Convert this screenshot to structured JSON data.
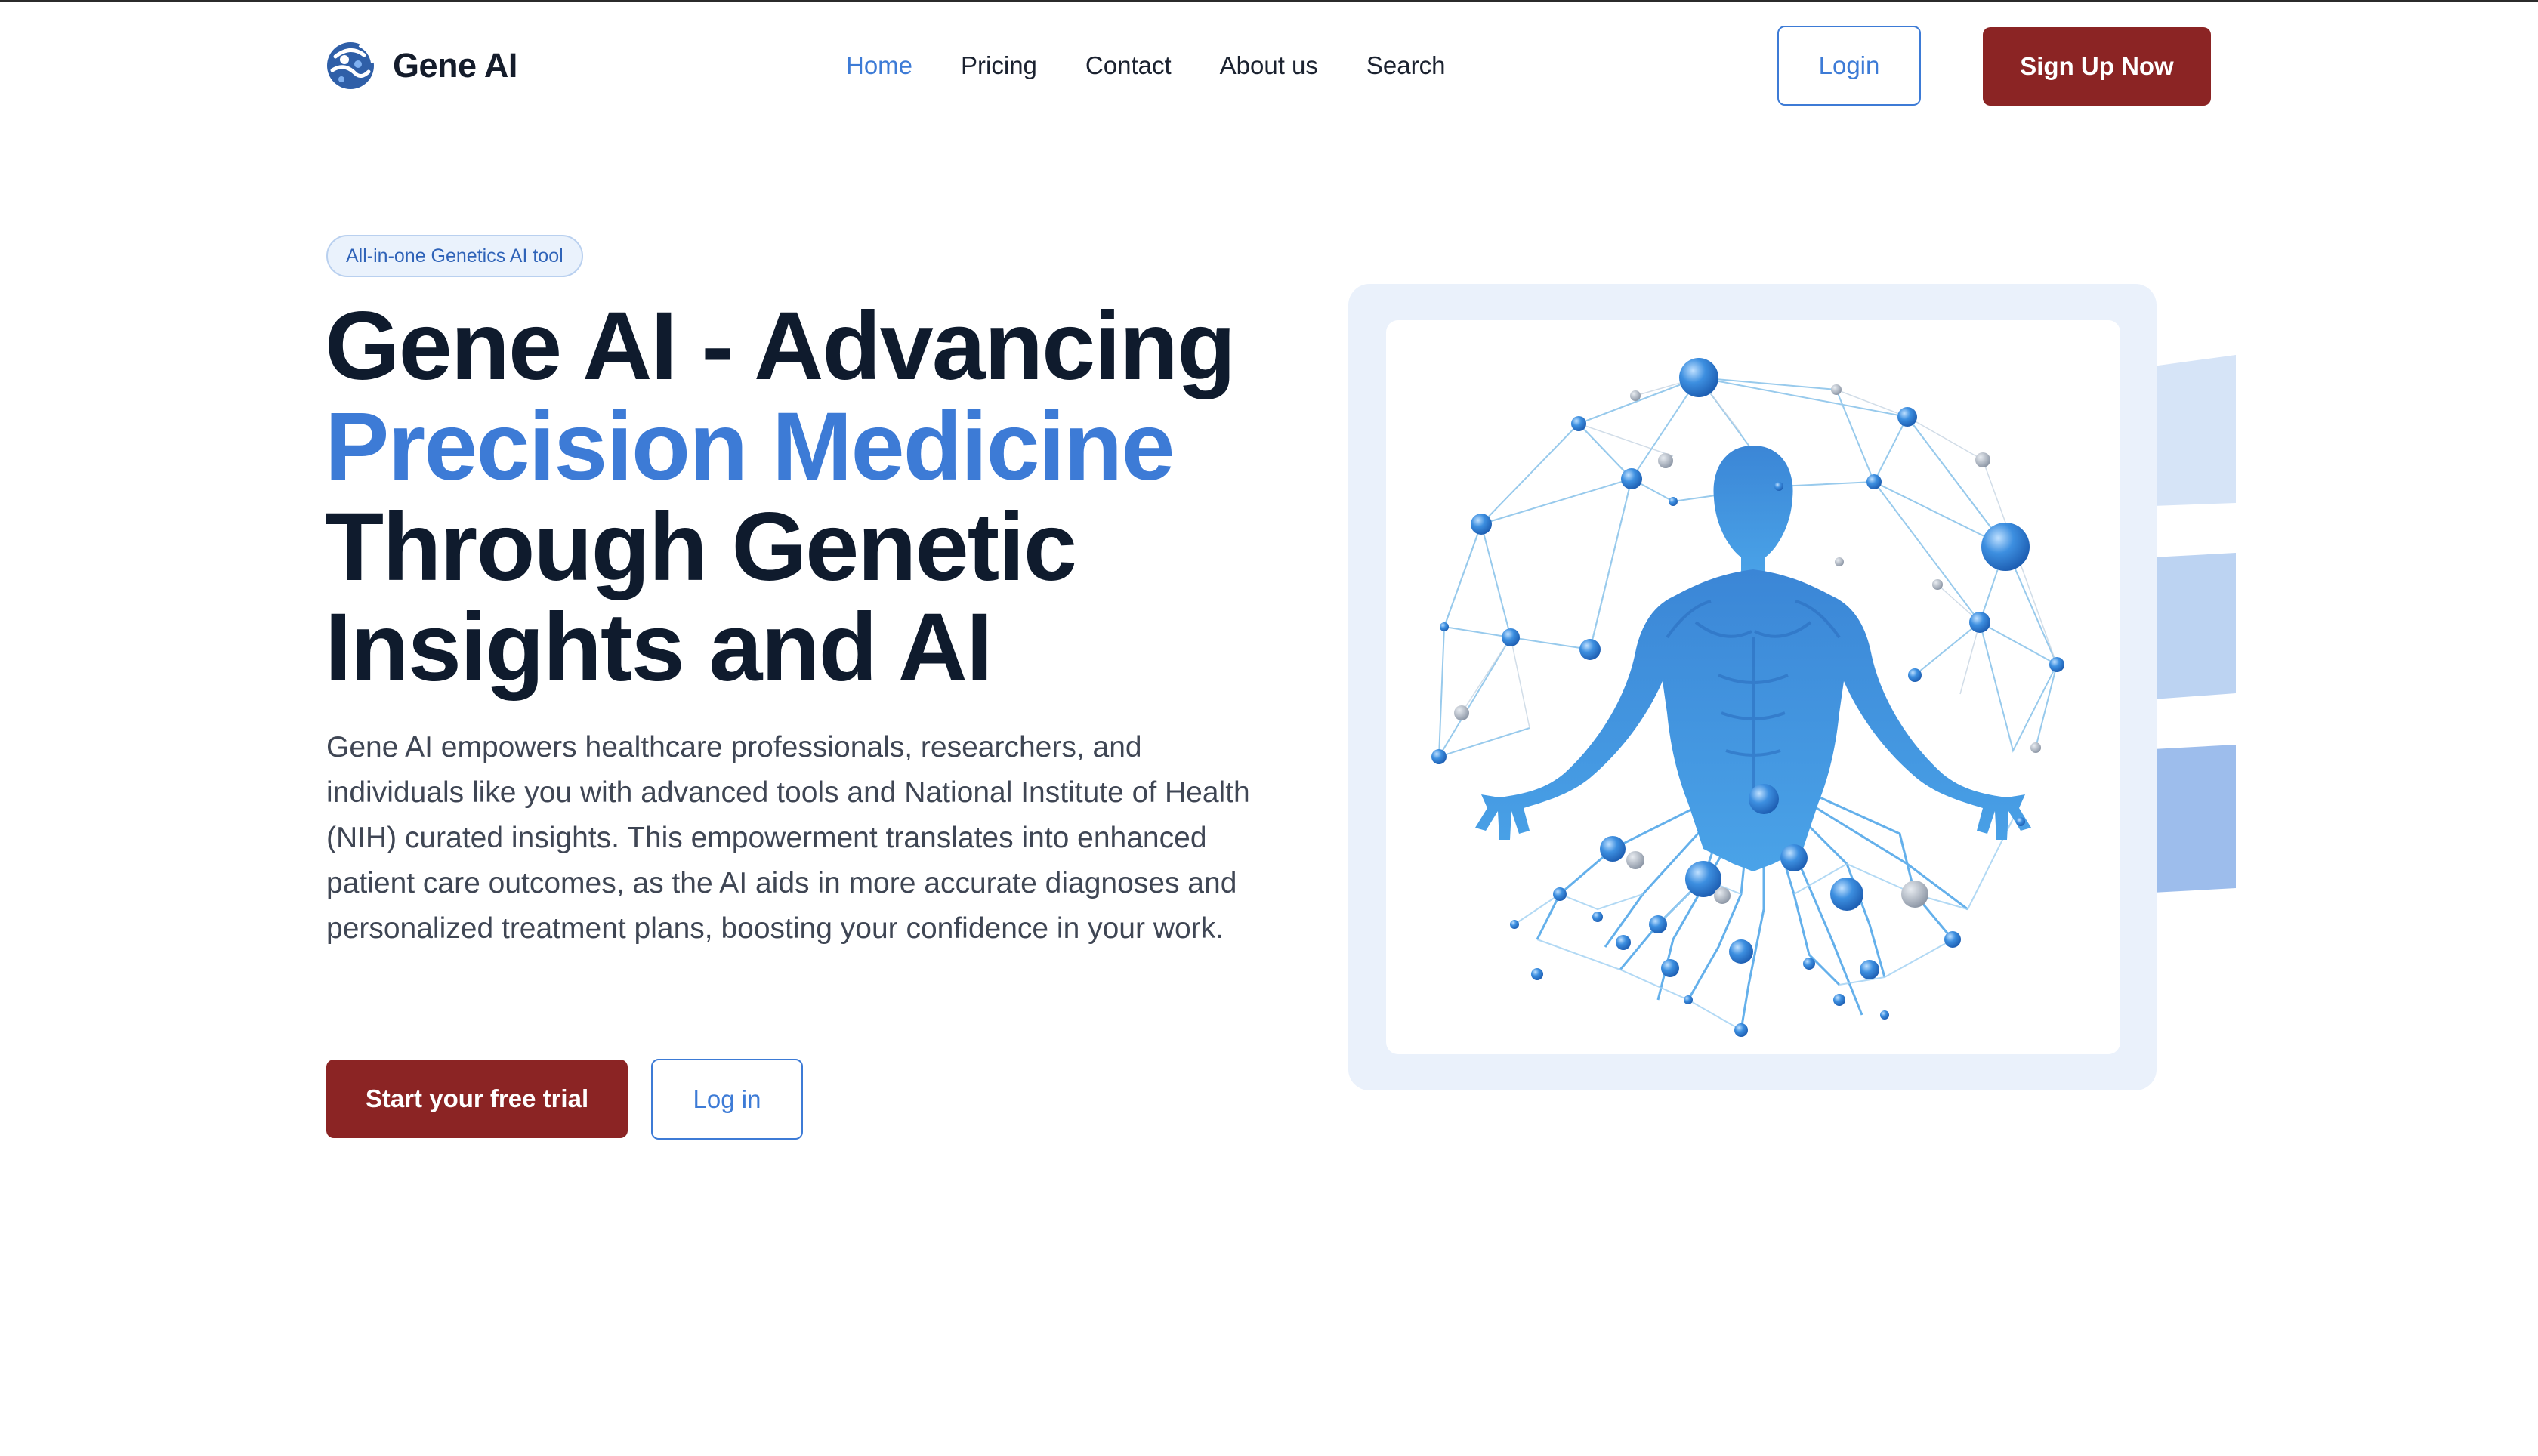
{
  "header": {
    "brand": "Gene AI",
    "nav": [
      {
        "label": "Home",
        "active": true
      },
      {
        "label": "Pricing",
        "active": false
      },
      {
        "label": "Contact",
        "active": false
      },
      {
        "label": "About us",
        "active": false
      },
      {
        "label": "Search",
        "active": false
      }
    ],
    "login_label": "Login",
    "signup_label": "Sign Up Now"
  },
  "hero": {
    "badge": "All-in-one Genetics AI tool",
    "headline_line1": "Gene AI - Advancing",
    "headline_line2": "Precision Medicine",
    "headline_line3": "Through Genetic",
    "headline_line4": "Insights and AI",
    "description": "Gene AI empowers healthcare professionals, researchers, and individuals like you with advanced tools and National Institute of Health (NIH) curated insights. This empowerment translates into enhanced patient care outcomes, as the AI aids in more accurate diagnoses and personalized treatment plans, boosting your confidence in your work.",
    "cta_primary": "Start your free trial",
    "cta_secondary": "Log in"
  },
  "illustration": {
    "icon": "human-body-network-illustration"
  },
  "colors": {
    "accent_blue": "#3d7bd6",
    "brand_red": "#8b2424",
    "heading": "#0f1b2d",
    "frame_bg": "#eaf1fb"
  }
}
